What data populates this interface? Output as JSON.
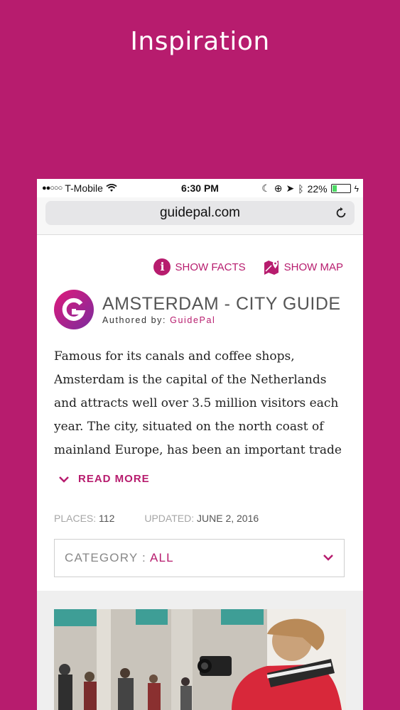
{
  "headline": "Inspiration",
  "status_bar": {
    "carrier": "T-Mobile",
    "time": "6:30 PM",
    "battery": "22%"
  },
  "browser": {
    "url": "guidepal.com"
  },
  "actions": {
    "show_facts": "SHOW FACTS",
    "show_map": "SHOW MAP"
  },
  "guide": {
    "title": "AMSTERDAM - CITY GUIDE",
    "author_prefix": "Authored by:",
    "author_name": "GuidePal",
    "description": "Famous for its canals and coffee shops, Amsterdam is the capital of the Netherlands and attracts well over 3.5 million visitors each year. The city, situated on the north coast of mainland Europe, has been an important trade centre since",
    "read_more": "READ MORE",
    "places_label": "PLACES:",
    "places_value": "112",
    "updated_label": "UPDATED:",
    "updated_value": "JUNE 2, 2016"
  },
  "category": {
    "label": "CATEGORY :",
    "value": "ALL"
  },
  "colors": {
    "brand": "#b71c6e",
    "background": "#b71c6e"
  },
  "icons": [
    "info-icon",
    "map-pin-icon",
    "chevron-down-icon",
    "reload-icon",
    "wifi-icon",
    "battery-icon",
    "guidepal-logo"
  ]
}
